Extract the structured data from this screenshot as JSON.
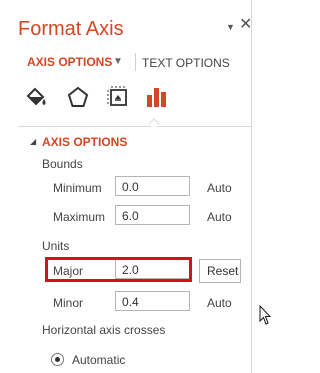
{
  "pane": {
    "title": "Format Axis",
    "menu_glyph": "▼",
    "close_glyph": "✕"
  },
  "tabs": {
    "axis_options": "AXIS OPTIONS",
    "dropdown_glyph": "▼",
    "text_options": "TEXT OPTIONS"
  },
  "icons": [
    "fill-line-icon",
    "effects-icon",
    "size-properties-icon",
    "axis-options-icon"
  ],
  "section": {
    "collapse_glyph": "◢",
    "title": "AXIS OPTIONS"
  },
  "bounds": {
    "label": "Bounds",
    "minimum_label": "Minimum",
    "minimum_value": "0.0",
    "minimum_state": "Auto",
    "maximum_label": "Maximum",
    "maximum_value": "6.0",
    "maximum_state": "Auto"
  },
  "units": {
    "label": "Units",
    "major_label": "Major",
    "major_value": "2.0",
    "major_button": "Reset",
    "minor_label": "Minor",
    "minor_value": "0.4",
    "minor_state": "Auto"
  },
  "crosses": {
    "label": "Horizontal axis crosses",
    "option_automatic": "Automatic"
  },
  "colors": {
    "accent": "#d24726",
    "highlight": "#d8101e"
  }
}
